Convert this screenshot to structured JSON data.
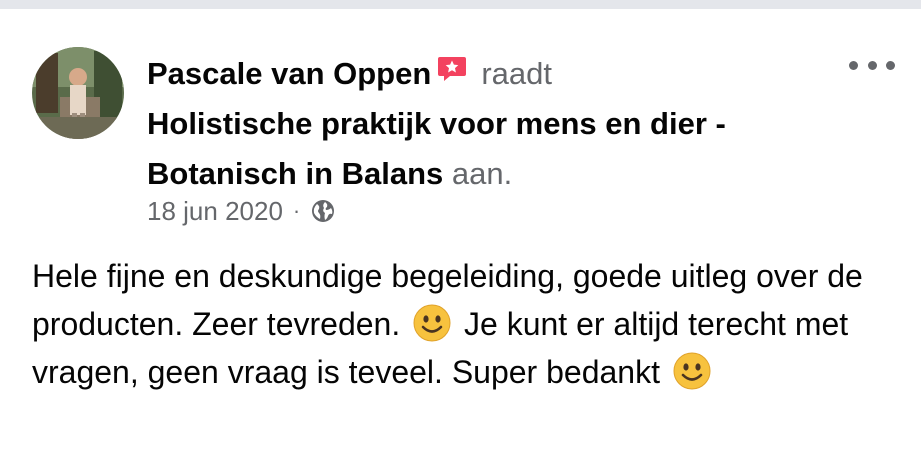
{
  "review": {
    "author": "Pascale van Oppen",
    "verb": "raadt",
    "page_name": "Holistische praktijk voor mens en dier - Botanisch in Balans",
    "suffix": "aan.",
    "date": "18 jun 2020",
    "privacy_separator": "·",
    "body": {
      "part1": "Hele fijne en deskundige begeleiding, goede uitleg over de producten. Zeer tevreden.",
      "part2": "Je kunt er altijd terecht met vragen, geen vraag is teveel. Super bedankt"
    }
  },
  "icons": {
    "badge": "recommend-badge-icon",
    "privacy": "globe-icon",
    "emoji": "smiley-icon",
    "more": "more-options-icon"
  },
  "colors": {
    "text": "#050505",
    "muted": "#65676b",
    "badge": "#f3425f",
    "emoji": "#f7c23e"
  }
}
